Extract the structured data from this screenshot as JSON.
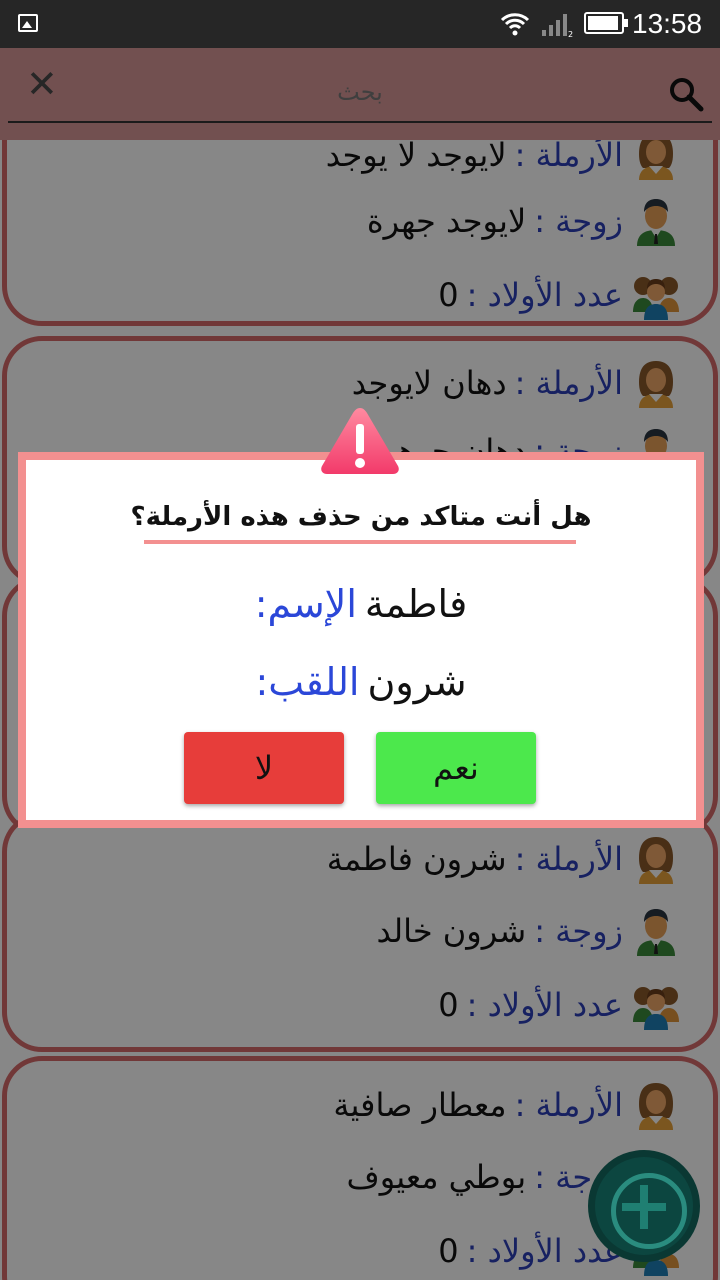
{
  "status_bar": {
    "time": "13:58"
  },
  "search": {
    "placeholder": "بحث"
  },
  "labels": {
    "widow": "الأرملة :",
    "wife": "زوجة :",
    "children": "عدد الأولاد :"
  },
  "cards": [
    {
      "widow": "لايوجد  لا يوجد",
      "wife": "لايوجد جهرة",
      "children": "0"
    },
    {
      "widow": "دهان  لايوجد",
      "wife": "دهان  جوهرة"
    },
    {
      "widow": "شرون  فاطمة",
      "wife": "شرون خالد",
      "children": "0"
    },
    {
      "widow": "معطار  صافية",
      "wife": "بوطي معيوف",
      "children": "0"
    }
  ],
  "dialog": {
    "title": "هل أنت متاكد من حذف هذه الأرملة؟",
    "name_label": "الإسم:",
    "name_value": "فاطمة",
    "surname_label": "اللقب:",
    "surname_value": "شرون",
    "yes_label": "نعم",
    "no_label": "لا"
  },
  "colors": {
    "accent": "#f39090",
    "card_border": "#d66b6b",
    "label_blue": "#2d3fb8",
    "yes_green": "#4ce84c",
    "no_red": "#e73d3a",
    "fab": "#0c4640"
  },
  "icons": {
    "widow": "woman-avatar-icon",
    "wife": "man-avatar-icon",
    "children": "family-avatar-icon",
    "warning": "warning-triangle-icon",
    "add": "add-icon"
  }
}
